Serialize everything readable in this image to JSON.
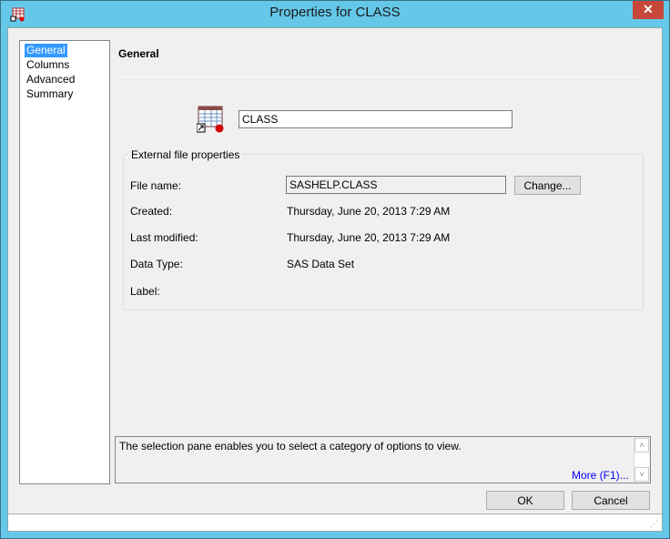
{
  "window": {
    "title": "Properties for CLASS",
    "close_label": "✕",
    "app_icon": "sas-table-icon"
  },
  "sidebar": {
    "items": [
      {
        "label": "General",
        "selected": true
      },
      {
        "label": "Columns"
      },
      {
        "label": "Advanced"
      },
      {
        "label": "Summary"
      }
    ]
  },
  "main": {
    "header": "General",
    "name_value": "CLASS",
    "group_label": "External file properties",
    "fields": {
      "file_name": {
        "label": "File name:",
        "value": "SASHELP.CLASS"
      },
      "change_button": "Change...",
      "created": {
        "label": "Created:",
        "value": "Thursday, June 20, 2013 7:29 AM"
      },
      "last_modified": {
        "label": "Last modified:",
        "value": "Thursday, June 20, 2013 7:29 AM"
      },
      "data_type": {
        "label": "Data Type:",
        "value": "SAS Data Set"
      },
      "label": {
        "label": "Label:",
        "value": ""
      }
    }
  },
  "description": {
    "text": "The selection pane enables you to select a category of options to view.",
    "more_link": "More (F1)...",
    "scroll_up": "˄",
    "scroll_down": "˅"
  },
  "buttons": {
    "ok": "OK",
    "cancel": "Cancel"
  },
  "statusbar": {
    "grip": "⋰"
  },
  "colors": {
    "selection": "#3399ff",
    "link": "#0000ff",
    "frame": "#65c8e8",
    "close": "#c7473a"
  }
}
